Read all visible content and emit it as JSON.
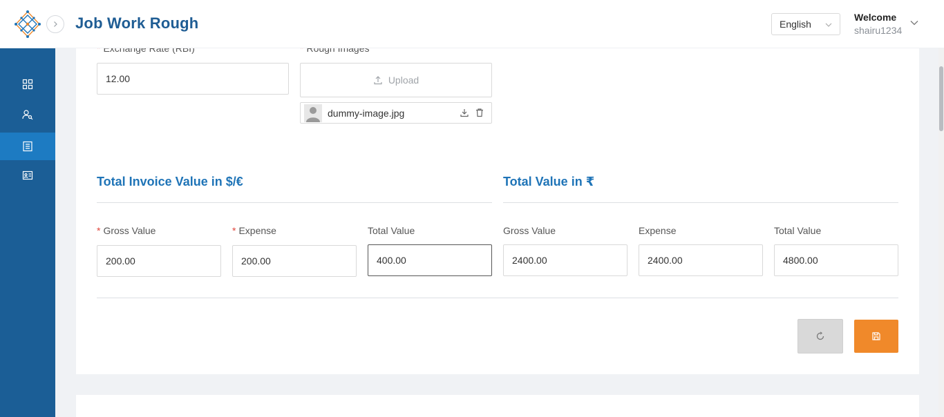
{
  "header": {
    "title": "Job Work Rough",
    "language": "English",
    "welcome": "Welcome",
    "username": "shairu1234"
  },
  "sidebar": {
    "items": [
      {
        "icon": "dashboard-grid-icon",
        "active": false
      },
      {
        "icon": "user-search-icon",
        "active": false
      },
      {
        "icon": "list-document-icon",
        "active": true
      },
      {
        "icon": "id-card-icon",
        "active": false
      }
    ]
  },
  "form": {
    "exchange_rate": {
      "label": "Exchange Rate (RBI)",
      "value": "12.00"
    },
    "rough_images": {
      "label": "Rough Images",
      "upload_label": "Upload",
      "file_name": "dummy-image.jpg"
    },
    "invoice_section": {
      "title": "Total Invoice Value in $/€",
      "gross": {
        "label": "Gross Value",
        "value": "200.00"
      },
      "expense": {
        "label": "Expense",
        "value": "200.00"
      },
      "total": {
        "label": "Total Value",
        "value": "400.00"
      }
    },
    "inr_section": {
      "title": "Total Value in ₹",
      "gross": {
        "label": "Gross Value",
        "value": "2400.00"
      },
      "expense": {
        "label": "Expense",
        "value": "2400.00"
      },
      "total": {
        "label": "Total Value",
        "value": "4800.00"
      }
    }
  },
  "colors": {
    "brand": "#1b5e96",
    "active_nav": "#1d7bc2",
    "title": "#1f5d94",
    "section": "#1f74b7",
    "save": "#f0892a",
    "required": "#e0443a"
  }
}
